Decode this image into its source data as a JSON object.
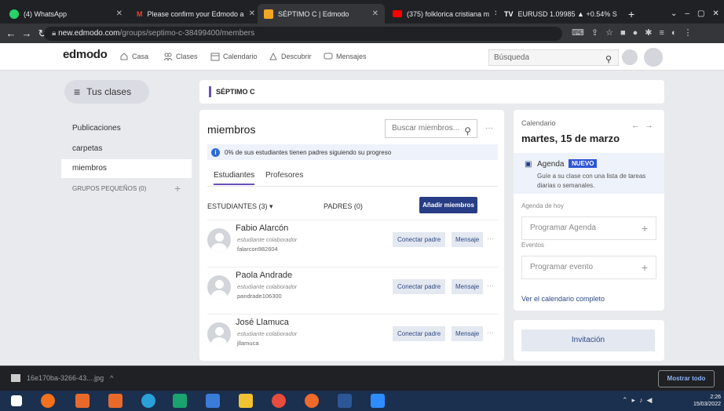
{
  "browser": {
    "tabs": [
      {
        "label": "(4) WhatsApp",
        "color": "#25d366"
      },
      {
        "label": "Please confirm your Edmodo a",
        "color": "#ea4335"
      },
      {
        "label": "SÉPTIMO C | Edmodo",
        "color": "#f5a623"
      },
      {
        "label": "(375) folklorica cristiana m",
        "color": "#ff0000"
      },
      {
        "label": "EURUSD 1.09985 ▲ +0.54% S",
        "color": "#131722"
      }
    ],
    "url_domain": "new.edmodo.com",
    "url_path": "/groups/septimo-c-38499400/members"
  },
  "header": {
    "logo": "edmodo",
    "nav": [
      "Casa",
      "Clases",
      "Calendario",
      "Descubrir",
      "Mensajes"
    ],
    "search_placeholder": "Búsqueda"
  },
  "sidebar": {
    "class_button": "Tus clases",
    "items": [
      "Publicaciones",
      "carpetas",
      "miembros"
    ],
    "groups_label": "GRUPOS PEQUEÑOS (0)"
  },
  "class_title": "SÉPTIMO C",
  "members": {
    "title": "miembros",
    "search_placeholder": "Buscar miembros...",
    "banner": "0% de sus estudiantes tienen padres siguiendo su progreso",
    "tabs": [
      "Estudiantes",
      "Profesores"
    ],
    "students_label": "ESTUDIANTES  (3) ▾",
    "parents_label": "PADRES (0)",
    "add_button": "Añadir miembros",
    "rows": [
      {
        "name": "Fabio Alarcón",
        "role": "estudiante colaborador",
        "user": "falarcon982604"
      },
      {
        "name": "Paola Andrade",
        "role": "estudiante colaborador",
        "user": "pandrade106300"
      },
      {
        "name": "José Llamuca",
        "role": "estudiante colaborador",
        "user": "jllamuca"
      }
    ],
    "connect_label": "Conectar padre",
    "message_label": "Mensaje"
  },
  "calendar": {
    "label": "Calendario",
    "date": "martes, 15 de marzo",
    "agenda_title": "Agenda",
    "new_badge": "NUEVO",
    "agenda_desc": "Guíe a su clase con una lista de tareas diarias o semanales.",
    "today_label": "Agenda de hoy",
    "program_agenda": "Programar Agenda",
    "events_label": "Eventos",
    "program_event": "Programar evento",
    "view_all": "Ver el calendario completo"
  },
  "invite_label": "Invitación",
  "downloads": {
    "file": "16e170ba-3266-43....jpg",
    "show_all": "Mostrar todo"
  },
  "clock": {
    "time": "2:26",
    "date": "15/03/2022"
  }
}
